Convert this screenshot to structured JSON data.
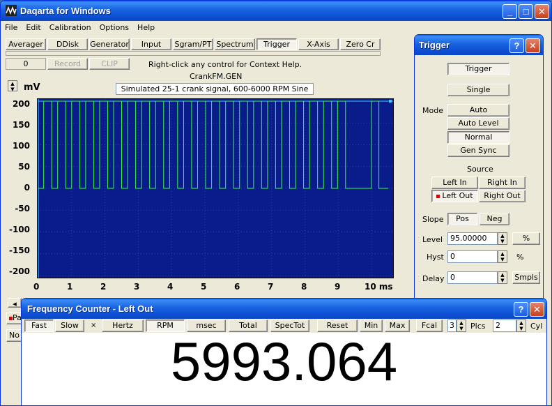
{
  "main_window": {
    "title": "Daqarta for Windows",
    "menu": [
      "File",
      "Edit",
      "Calibration",
      "Options",
      "Help"
    ],
    "toolbar_row1": [
      "Averager",
      "DDisk",
      "Generator",
      "Input",
      "Sgram/PT",
      "Spectrum",
      "Trigger",
      "X-Axis",
      "Zero Cr"
    ],
    "counter_value": "0",
    "record_label": "Record",
    "clip_label": "CLIP",
    "context_help": "Right-click any control for Context Help.",
    "file_name": "CrankFM.GEN",
    "signal_desc": "Simulated 25-1 crank signal, 600-6000 RPM Sine",
    "y_unit": "mV",
    "bottom_left_1": "Pa",
    "bottom_left_2": "No"
  },
  "chart_data": {
    "type": "line",
    "title": "",
    "xlabel": "ms",
    "ylabel": "mV",
    "xlim": [
      0,
      10.5
    ],
    "ylim": [
      -200,
      200
    ],
    "x_ticks": [
      "0",
      "1",
      "2",
      "3",
      "4",
      "5",
      "6",
      "7",
      "8",
      "9",
      "10 ms"
    ],
    "y_ticks": [
      "200",
      "150",
      "100",
      "50",
      "0",
      "-50",
      "-100",
      "-150",
      "-200"
    ],
    "series": [
      {
        "color": "#33ff33",
        "high": 200,
        "low": 0,
        "rising_edges_ms": [
          0.16,
          0.58,
          1.0,
          1.42,
          1.84,
          2.26,
          2.68,
          3.1,
          3.52,
          3.94,
          4.36,
          4.78,
          5.2,
          5.62,
          6.04,
          6.46,
          6.88,
          7.3,
          7.72,
          8.14,
          8.56,
          8.98,
          10.0
        ],
        "falling_edges_ms": [
          0.4,
          0.82,
          1.24,
          1.66,
          2.08,
          2.5,
          2.92,
          3.34,
          3.76,
          4.18,
          4.6,
          5.02,
          5.44,
          5.86,
          6.28,
          6.7,
          7.12,
          7.54,
          7.96,
          8.38,
          8.8,
          9.22,
          10.22
        ],
        "trigger_level_line": 200
      }
    ]
  },
  "trigger_panel": {
    "title": "Trigger",
    "trigger_btn": "Trigger",
    "single_btn": "Single",
    "mode_label": "Mode",
    "mode_options": [
      "Auto",
      "Auto Level",
      "Normal",
      "Gen Sync"
    ],
    "source_label": "Source",
    "source_options": [
      "Left In",
      "Right In",
      "Left Out",
      "Right Out"
    ],
    "slope_label": "Slope",
    "slope_pos": "Pos",
    "slope_neg": "Neg",
    "level_label": "Level",
    "level_value": "95.00000",
    "level_unit_btn": "%",
    "hyst_label": "Hyst",
    "hyst_value": "0",
    "hyst_unit": "%",
    "delay_label": "Delay",
    "delay_value": "0",
    "delay_unit_btn": "Smpls"
  },
  "freq_counter": {
    "title": "Frequency Counter - Left Out",
    "buttons": [
      "Fast",
      "Slow",
      "Hertz",
      "RPM",
      "msec",
      "Total",
      "SpecTot",
      "Reset",
      "Min",
      "Max",
      "Fcal"
    ],
    "dot": "×",
    "plcs_value": "3",
    "plcs_label": "Plcs",
    "cyl_value": "2",
    "cyl_label": "Cyl",
    "reading": "5993.064"
  }
}
